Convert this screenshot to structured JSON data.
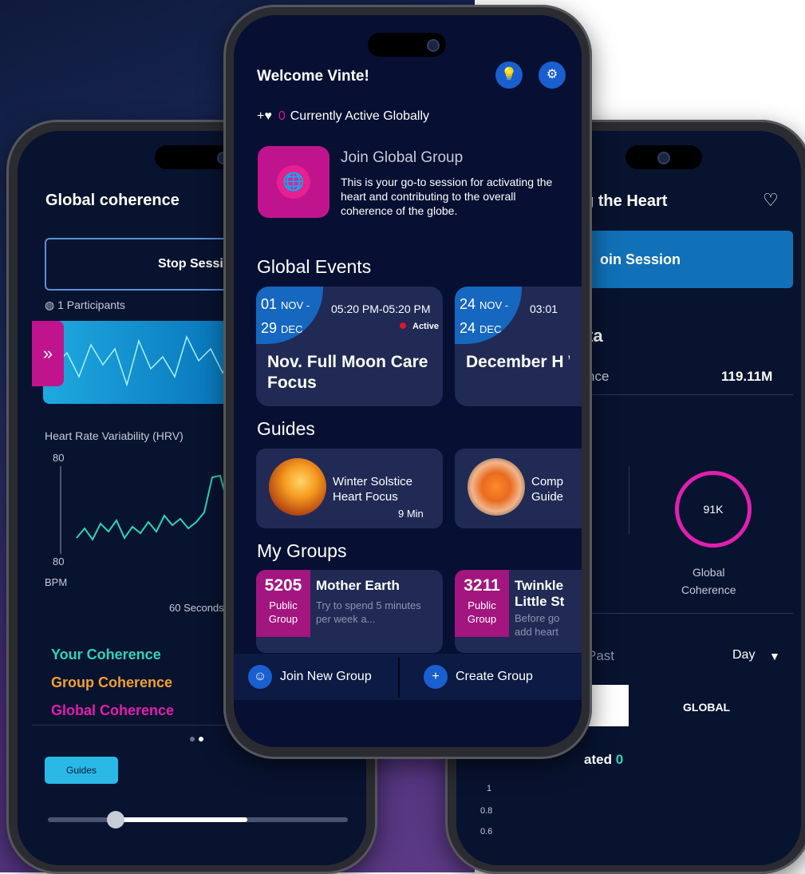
{
  "left_screen": {
    "title": "Global coherence",
    "stop_button": "Stop Sessio",
    "participants": "1 Participants",
    "expand_glyph": "»",
    "hrv_label": "Heart Rate Variability (HRV)",
    "hrv_top": "80",
    "hrv_bottom": "80",
    "bpm_label": "BPM",
    "seconds_label": "60 Seconds",
    "your_coherence": "Your Coherence",
    "group_coherence": "Group Coherence",
    "global_coherence": "Global Coherence",
    "guides_button": "Guides",
    "slider_progress": 0.45,
    "colors": {
      "your": "#2ed4b4",
      "group": "#f0a12e",
      "global": "#e51cae"
    }
  },
  "right_screen": {
    "title": "g the Heart",
    "join_session": "oin Session",
    "section_label": "ta",
    "coherence_label": "nce",
    "coherence_value": "119.11M",
    "ring_value": "91K",
    "ring_label_1": "Global",
    "ring_label_2": "Coherence",
    "period_label": "Past",
    "period_value": "Day",
    "global_label": "GLOBAL",
    "created_label": "ated",
    "created_value": "0",
    "y_ticks": [
      "1",
      "0.8",
      "0.6"
    ]
  },
  "mid_screen": {
    "welcome": "Welcome",
    "username": "Vinte!",
    "active_count": "0",
    "active_text": "Currently Active Globally",
    "join_title": "Join Global Group",
    "join_desc": "This is your go-to session for activating the heart and contributing to the overall coherence of the globe.",
    "events_title": "Global Events",
    "events": [
      {
        "start": "01",
        "start_month": "NOV -",
        "end": "29",
        "end_month": "DEC",
        "time": "05:20 PM-05:20 PM",
        "status": "Active",
        "name": "Nov. Full Moon Care Focus"
      },
      {
        "start": "24",
        "start_month": "NOV -",
        "end": "24",
        "end_month": "DEC",
        "time": "03:01",
        "name": "December H Warmth and"
      }
    ],
    "guides_title": "Guides",
    "guides": [
      {
        "title": "Winter Solstice Heart Focus",
        "duration": "9 Min"
      },
      {
        "title": "Comp Guide"
      }
    ],
    "groups_title": "My Groups",
    "groups": [
      {
        "count": "5205",
        "type": "Public Group",
        "name": "Mother Earth",
        "desc": "Try to spend 5 minutes per week a..."
      },
      {
        "count": "3211",
        "type": "Public Group",
        "name": "Twinkle Little St",
        "desc": "Before go add heart"
      }
    ],
    "join_new_group": "Join New Group",
    "create_group": "Create Group",
    "accent": "#c0148f"
  }
}
